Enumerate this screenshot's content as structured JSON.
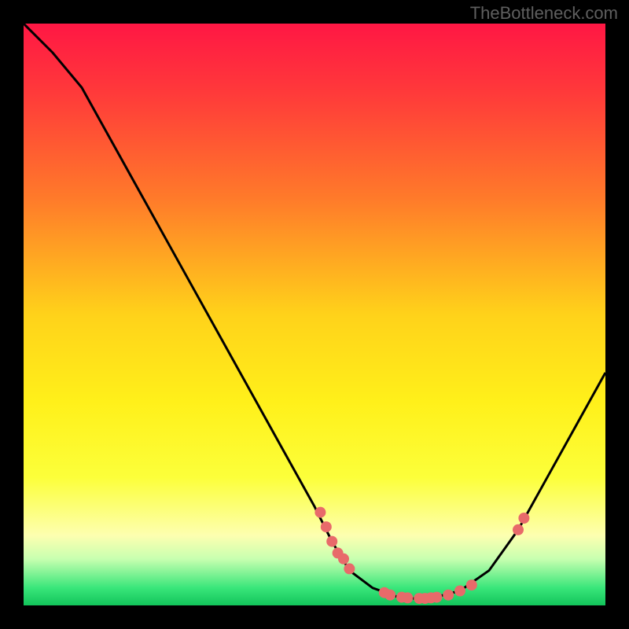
{
  "watermark": "TheBottleneck.com",
  "chart_data": {
    "type": "line",
    "title": "",
    "xlabel": "",
    "ylabel": "",
    "xlim": [
      0,
      100
    ],
    "ylim": [
      0,
      100
    ],
    "gradient_stops": [
      {
        "offset": 0,
        "color": "#ff1744"
      },
      {
        "offset": 0.12,
        "color": "#ff3a3a"
      },
      {
        "offset": 0.3,
        "color": "#ff7a2a"
      },
      {
        "offset": 0.5,
        "color": "#ffd21a"
      },
      {
        "offset": 0.65,
        "color": "#fff01a"
      },
      {
        "offset": 0.78,
        "color": "#fcff3a"
      },
      {
        "offset": 0.88,
        "color": "#fdffb0"
      },
      {
        "offset": 0.92,
        "color": "#c8ffb0"
      },
      {
        "offset": 0.97,
        "color": "#39e67a"
      },
      {
        "offset": 1.0,
        "color": "#12c45a"
      }
    ],
    "curve": [
      {
        "x": 0,
        "y": 100
      },
      {
        "x": 5,
        "y": 95
      },
      {
        "x": 10,
        "y": 89
      },
      {
        "x": 15,
        "y": 80
      },
      {
        "x": 20,
        "y": 71
      },
      {
        "x": 25,
        "y": 62
      },
      {
        "x": 30,
        "y": 53
      },
      {
        "x": 35,
        "y": 44
      },
      {
        "x": 40,
        "y": 35
      },
      {
        "x": 45,
        "y": 26
      },
      {
        "x": 50,
        "y": 17
      },
      {
        "x": 53,
        "y": 11
      },
      {
        "x": 56,
        "y": 6
      },
      {
        "x": 60,
        "y": 3
      },
      {
        "x": 65,
        "y": 1.2
      },
      {
        "x": 70,
        "y": 1.2
      },
      {
        "x": 75,
        "y": 2.5
      },
      {
        "x": 80,
        "y": 6
      },
      {
        "x": 85,
        "y": 13
      },
      {
        "x": 90,
        "y": 22
      },
      {
        "x": 95,
        "y": 31
      },
      {
        "x": 100,
        "y": 40
      }
    ],
    "markers": [
      {
        "x": 51,
        "y": 16
      },
      {
        "x": 52,
        "y": 13.5
      },
      {
        "x": 53,
        "y": 11
      },
      {
        "x": 54,
        "y": 9
      },
      {
        "x": 55,
        "y": 8
      },
      {
        "x": 56,
        "y": 6.3
      },
      {
        "x": 62,
        "y": 2.2
      },
      {
        "x": 63,
        "y": 1.8
      },
      {
        "x": 65,
        "y": 1.4
      },
      {
        "x": 66,
        "y": 1.3
      },
      {
        "x": 68,
        "y": 1.2
      },
      {
        "x": 69,
        "y": 1.2
      },
      {
        "x": 70,
        "y": 1.3
      },
      {
        "x": 71,
        "y": 1.4
      },
      {
        "x": 73,
        "y": 1.8
      },
      {
        "x": 75,
        "y": 2.5
      },
      {
        "x": 77,
        "y": 3.5
      },
      {
        "x": 85,
        "y": 13
      },
      {
        "x": 86,
        "y": 15
      }
    ],
    "marker_color": "#e86a6a",
    "marker_radius": 7
  }
}
